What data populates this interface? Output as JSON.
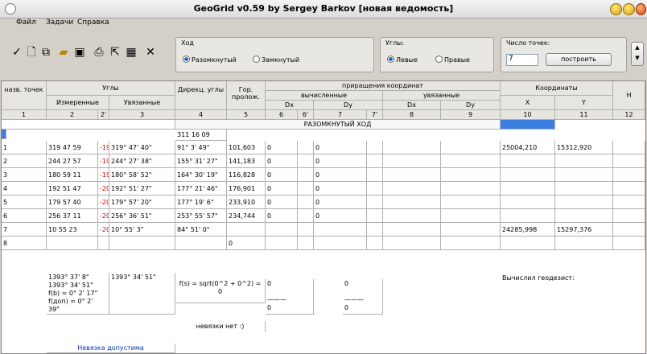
{
  "window": {
    "title": "GeoGrid v0.59 by Sergey Barkov [новая ведомость]"
  },
  "menu": [
    "Файл",
    "Задачи",
    "Справка"
  ],
  "toolbar": {
    "icons": [
      "check-icon",
      "new-doc-icon",
      "copy-icon",
      "open-folder-icon",
      "save-icon",
      "print-icon",
      "export-icon",
      "grid-icon",
      "close-icon"
    ]
  },
  "hod": {
    "label": "Ход",
    "options": [
      "Разомкнутый",
      "Замкнутый"
    ],
    "selected": "Разомкнутый"
  },
  "ugly_group": {
    "label": "Углы:",
    "options": [
      "Левые",
      "Правые"
    ],
    "selected": "Левые"
  },
  "points": {
    "label": "Число точек:",
    "value": "7",
    "button": "построить"
  },
  "headers": {
    "name": "назв. точек",
    "angles": "Углы",
    "measured": "Измеренные",
    "corrected": "Увязанные",
    "direction": "Дирекц. углы",
    "horiz": "Гор. пролож.",
    "increments": "приращения координат",
    "calculated": "вычисленные",
    "adjusted": "увязанные",
    "dx": "Dx",
    "dy": "Dy",
    "coords": "Координаты",
    "x": "X",
    "y": "Y",
    "h": "H",
    "nums": [
      "1",
      "2",
      "2'",
      "3",
      "4",
      "5",
      "6",
      "6'",
      "7",
      "7'",
      "8",
      "9",
      "10",
      "11",
      "12"
    ]
  },
  "banner": "РАЗОМКНУТЫЙ ХОД",
  "first_direction": "311 16 09",
  "rows": [
    {
      "n": "1",
      "meas": "319 47 59",
      "corr": "-19\"",
      "adj": "319° 47' 40\"",
      "dir": "91° 3' 49\"",
      "dist": "101,603",
      "dx": "0",
      "dy": "0",
      "x": "25004,210",
      "y": "15312,920"
    },
    {
      "n": "2",
      "meas": "244 27 57",
      "corr": "-19\"",
      "adj": "244° 27' 38\"",
      "dir": "155° 31' 27\"",
      "dist": "141,183",
      "dx": "0",
      "dy": "0",
      "x": "",
      "y": ""
    },
    {
      "n": "3",
      "meas": "180 59 11",
      "corr": "-19\"",
      "adj": "180° 58' 52\"",
      "dir": "164° 30' 19\"",
      "dist": "116,828",
      "dx": "0",
      "dy": "0",
      "x": "",
      "y": ""
    },
    {
      "n": "4",
      "meas": "192 51 47",
      "corr": "-20\"",
      "adj": "192° 51' 27\"",
      "dir": "177° 21' 46\"",
      "dist": "176,901",
      "dx": "0",
      "dy": "0",
      "x": "",
      "y": ""
    },
    {
      "n": "5",
      "meas": "179 57 40",
      "corr": "-20\"",
      "adj": "179° 57' 20\"",
      "dir": "177° 19' 6\"",
      "dist": "233,910",
      "dx": "0",
      "dy": "0",
      "x": "",
      "y": ""
    },
    {
      "n": "6",
      "meas": "256 37 11",
      "corr": "-20\"",
      "adj": "256° 36' 51\"",
      "dir": "253° 55' 57\"",
      "dist": "234,744",
      "dx": "0",
      "dy": "0",
      "x": "",
      "y": ""
    },
    {
      "n": "7",
      "meas": "10 55 23",
      "corr": "-20\"",
      "adj": "10° 55' 3\"",
      "dir": "84° 51' 0\"",
      "dist": "",
      "dx": "",
      "dy": "",
      "x": "24285,998",
      "y": "15297,376"
    },
    {
      "n": "8",
      "meas": "",
      "corr": "",
      "adj": "",
      "dir": "",
      "dist": "0",
      "dx": "",
      "dy": "",
      "x": "",
      "y": ""
    }
  ],
  "summary": {
    "angles_text": "1393° 37' 8\"\n1393° 34' 51\"\nf(b) = 0° 2' 17\"\nf(доп) = 0° 2'\n39\"",
    "corr_sum": "1393° 34' 51\"",
    "fs_text": "f(s) = sqrt(0^2 + 0^2) =\n0",
    "residual_text": "невязки нет :)",
    "dx_col": "0\n\n———\n0",
    "dy_col": "0\n\n———\n0",
    "calc_label": "Вычислил геодезист:",
    "status": "Невязка допустима"
  }
}
